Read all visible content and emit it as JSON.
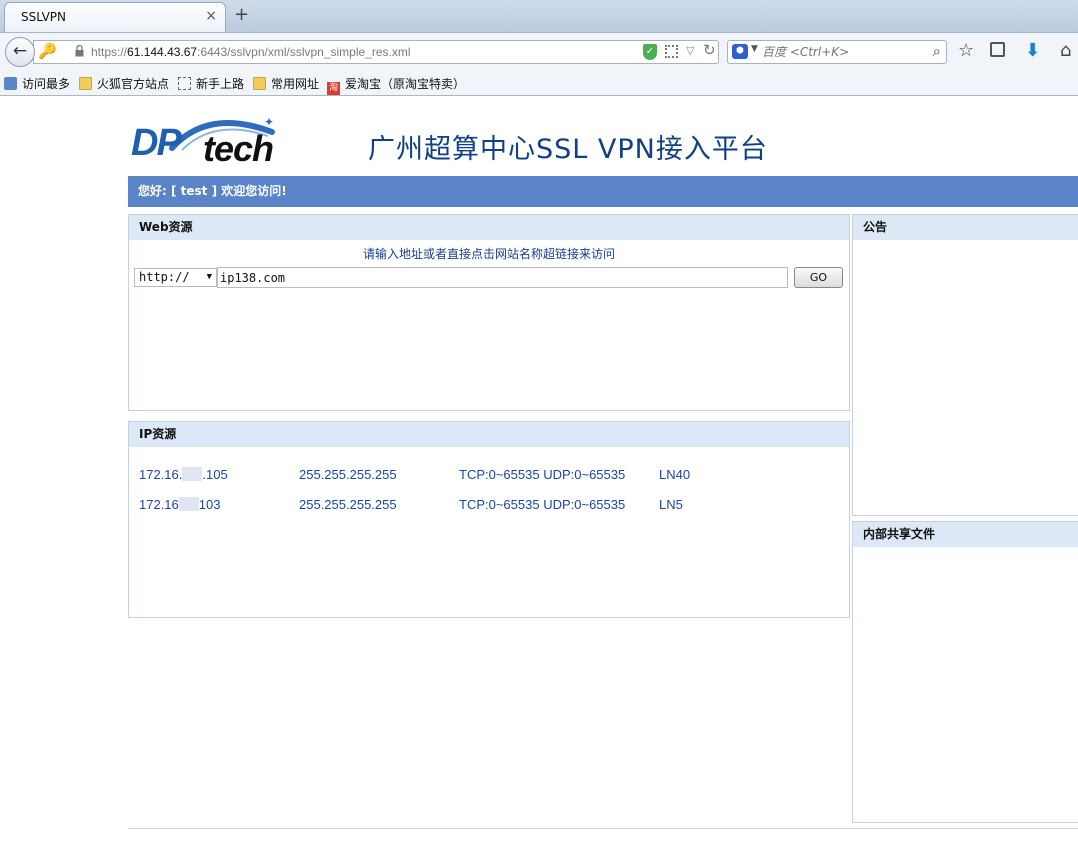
{
  "browser": {
    "tab_title": "SSLVPN",
    "tab_close": "×",
    "new_tab": "+",
    "url_prefix": "https://",
    "url_host": "61.144.43.67",
    "url_rest": ":6443/sslvpn/xml/sslvpn_simple_res.xml",
    "search_placeholder": "百度 <Ctrl+K>",
    "bookmarks": [
      "访问最多",
      "火狐官方站点",
      "新手上路",
      "常用网址",
      "爱淘宝（原淘宝特卖）"
    ]
  },
  "header": {
    "logo_dp": "DP",
    "logo_tech": "tech",
    "title": "广州超算中心SSL VPN接入平台",
    "welcome": "您好: [ test ]  欢迎您访问!"
  },
  "web_panel": {
    "title": "Web资源",
    "hint": "请输入地址或者直接点击网站名称超链接来访问",
    "protocol": "http://",
    "url_value": "ip138.com",
    "go_label": "GO"
  },
  "ip_panel": {
    "title": "IP资源",
    "rows": [
      {
        "ip_prefix": "172.16.",
        "ip_suffix": ".105",
        "mask": "255.255.255.255",
        "ports": "TCP:0~65535 UDP:0~65535",
        "name": "LN40"
      },
      {
        "ip_prefix": "172.16",
        "ip_suffix": "103",
        "mask": "255.255.255.255",
        "ports": "TCP:0~65535 UDP:0~65535",
        "name": "LN5"
      }
    ]
  },
  "notice_panel": {
    "title": "公告"
  },
  "files_panel": {
    "title": "内部共享文件"
  }
}
